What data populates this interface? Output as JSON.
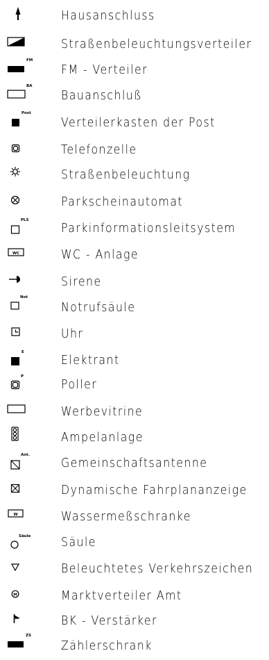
{
  "legend": {
    "items": [
      {
        "icon": "arrow-up-icon",
        "label": "Hausanschluss"
      },
      {
        "icon": "diagonal-half-filled-box-icon",
        "label": "Straßenbeleuchtungsverteiler"
      },
      {
        "icon": "filled-box-fm-icon",
        "tag": "FM",
        "label": "FM - Verteiler"
      },
      {
        "icon": "empty-box-ba-icon",
        "tag": "BA",
        "label": "Bauanschluß"
      },
      {
        "icon": "filled-square-post-icon",
        "tag": "Post",
        "label": "Verteilerkasten der Post"
      },
      {
        "icon": "rounded-square-icon",
        "label": "Telefonzelle"
      },
      {
        "icon": "sun-icon",
        "label": "Straßenbeleuchtung"
      },
      {
        "icon": "circle-cross-icon",
        "label": "Parkscheinautomat"
      },
      {
        "icon": "square-pls-icon",
        "tag": "PLS",
        "label": "Parkinformationsleitsystem"
      },
      {
        "icon": "wc-box-icon",
        "tag": "WC",
        "label": "WC - Anlage"
      },
      {
        "icon": "siren-icon",
        "label": "Sirene"
      },
      {
        "icon": "square-not-icon",
        "tag": "Not",
        "label": "Notrufsäule"
      },
      {
        "icon": "clock-square-icon",
        "label": "Uhr"
      },
      {
        "icon": "filled-square-e-icon",
        "tag": "E",
        "label": "Elektrant"
      },
      {
        "icon": "bollard-icon",
        "tag": "P",
        "label": "Poller"
      },
      {
        "icon": "empty-rectangle-icon",
        "label": "Werbevitrine"
      },
      {
        "icon": "traffic-light-icon",
        "label": "Ampelanlage"
      },
      {
        "icon": "antenna-square-icon",
        "tag": "Ant.",
        "label": "Gemeinschaftsantenne"
      },
      {
        "icon": "crossed-square-icon",
        "label": "Dynamische Fahrplananzeige"
      },
      {
        "icon": "w-box-icon",
        "tag": "W",
        "label": "Wassermeßschranke"
      },
      {
        "icon": "column-circle-icon",
        "tag": "Säule",
        "label": "Säule"
      },
      {
        "icon": "triangle-down-icon",
        "label": "Beleuchtetes Verkehrszeichen"
      },
      {
        "icon": "circle-m-icon",
        "tag": "M",
        "label": "Marktverteiler Amt"
      },
      {
        "icon": "flag-icon",
        "label": "BK - Verstärker"
      },
      {
        "icon": "filled-box-zs-icon",
        "tag": "ZS",
        "label": "Zählerschrank"
      }
    ]
  }
}
